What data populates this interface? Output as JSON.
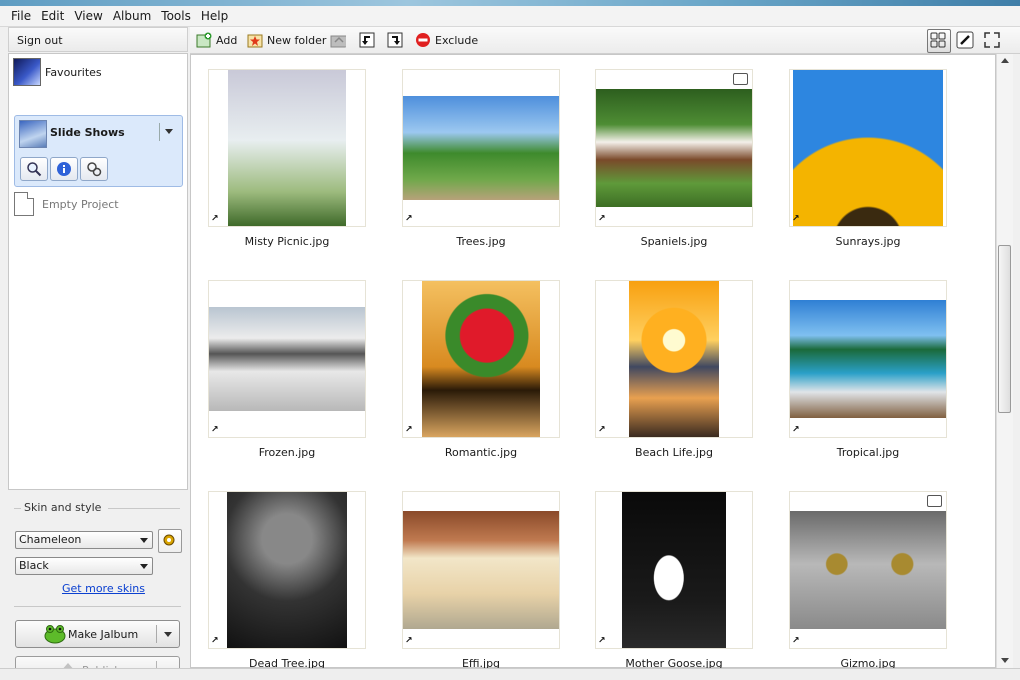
{
  "menu": [
    "File",
    "Edit",
    "View",
    "Album",
    "Tools",
    "Help"
  ],
  "left": {
    "sign_out": "Sign out",
    "favourites": "Favourites",
    "slide_shows": "Slide Shows",
    "empty_project": "Empty Project",
    "skin_legend": "Skin and style",
    "skin": "Chameleon",
    "style": "Black",
    "more_skins": "Get more skins",
    "make": "Make Jalbum",
    "publish": "Publish"
  },
  "toolbar": {
    "add": "Add",
    "new_folder": "New folder",
    "exclude": "Exclude"
  },
  "images": [
    {
      "name": "Misty Picnic.jpg",
      "comment": false
    },
    {
      "name": "Trees.jpg",
      "comment": false
    },
    {
      "name": "Spaniels.jpg",
      "comment": true
    },
    {
      "name": "Sunrays.jpg",
      "comment": false
    },
    {
      "name": "Frozen.jpg",
      "comment": false
    },
    {
      "name": "Romantic.jpg",
      "comment": false
    },
    {
      "name": "Beach Life.jpg",
      "comment": false
    },
    {
      "name": "Tropical.jpg",
      "comment": false
    },
    {
      "name": "Dead Tree.jpg",
      "comment": false
    },
    {
      "name": "Effi.jpg",
      "comment": false
    },
    {
      "name": "Mother Goose.jpg",
      "comment": false
    },
    {
      "name": "Gizmo.jpg",
      "comment": true
    }
  ],
  "colors": {
    "selection": "#dbe9fb",
    "link": "#0b40d0",
    "accent": "#5a8db0"
  }
}
